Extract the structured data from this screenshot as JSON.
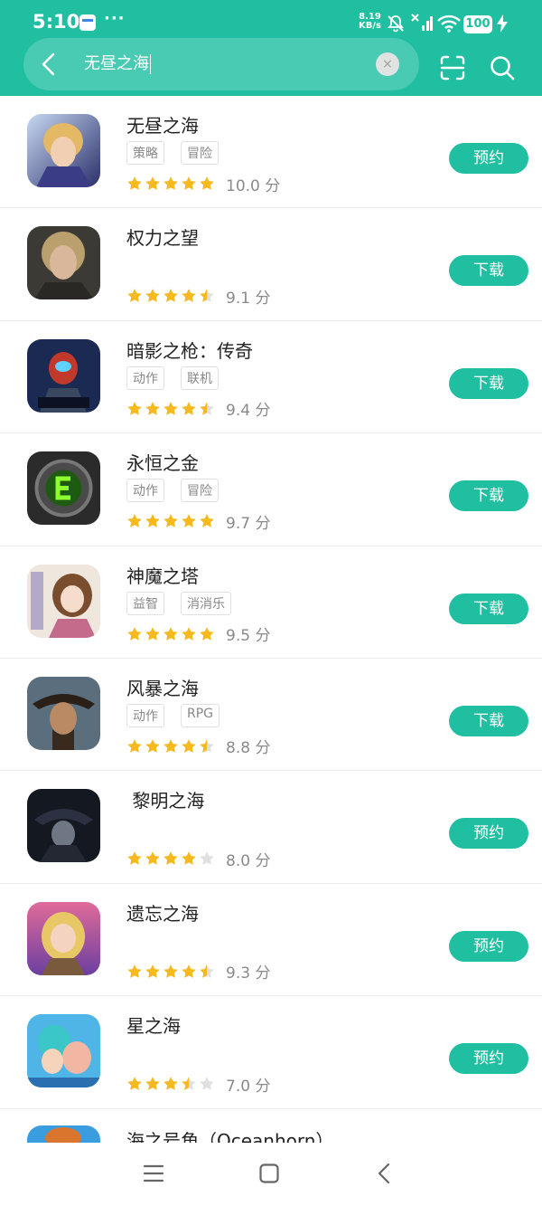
{
  "status": {
    "time": "5:10",
    "dots": "···",
    "speed_value": "8.19",
    "speed_unit": "KB/s",
    "battery": "100"
  },
  "search": {
    "query": "无昼之海",
    "clear_label": "×"
  },
  "colors": {
    "accent": "#21bfa1",
    "star": "#f6b91e",
    "star_empty": "#e0e0e0"
  },
  "results": [
    {
      "name": "无昼之海",
      "tags": [
        "策略",
        "冒险"
      ],
      "stars": 5,
      "score": "10.0 分",
      "button": "预约",
      "icon": "fantasy-hero-icon"
    },
    {
      "name": "权力之望",
      "tags": [],
      "stars": 4.5,
      "score": "9.1 分",
      "button": "下载",
      "icon": "portrait-icon"
    },
    {
      "name": "暗影之枪：传奇",
      "tags": [
        "动作",
        "联机"
      ],
      "stars": 4.5,
      "score": "9.4 分",
      "button": "下载",
      "icon": "shadowgun-icon"
    },
    {
      "name": "永恒之金",
      "tags": [
        "动作",
        "冒险"
      ],
      "stars": 5,
      "score": "9.7 分",
      "button": "下载",
      "icon": "emblem-icon"
    },
    {
      "name": "神魔之塔",
      "tags": [
        "益智",
        "消消乐"
      ],
      "stars": 5,
      "score": "9.5 分",
      "button": "下载",
      "icon": "anime-girl-icon"
    },
    {
      "name": "风暴之海",
      "tags": [
        "动作",
        "RPG"
      ],
      "stars": 4.5,
      "score": "8.8 分",
      "button": "下载",
      "icon": "pirate-icon"
    },
    {
      "name": " 黎明之海",
      "tags": [],
      "stars": 4,
      "score": "8.0 分",
      "button": "预约",
      "icon": "hooded-figure-icon"
    },
    {
      "name": "遗忘之海",
      "tags": [],
      "stars": 4.5,
      "score": "9.3 分",
      "button": "预约",
      "icon": "blonde-girl-icon"
    },
    {
      "name": "星之海",
      "tags": [],
      "stars": 3.5,
      "score": "7.0 分",
      "button": "预约",
      "icon": "ocean-heroes-icon"
    }
  ],
  "partial_result": {
    "name": "海之号角（Oceanhorn）"
  }
}
